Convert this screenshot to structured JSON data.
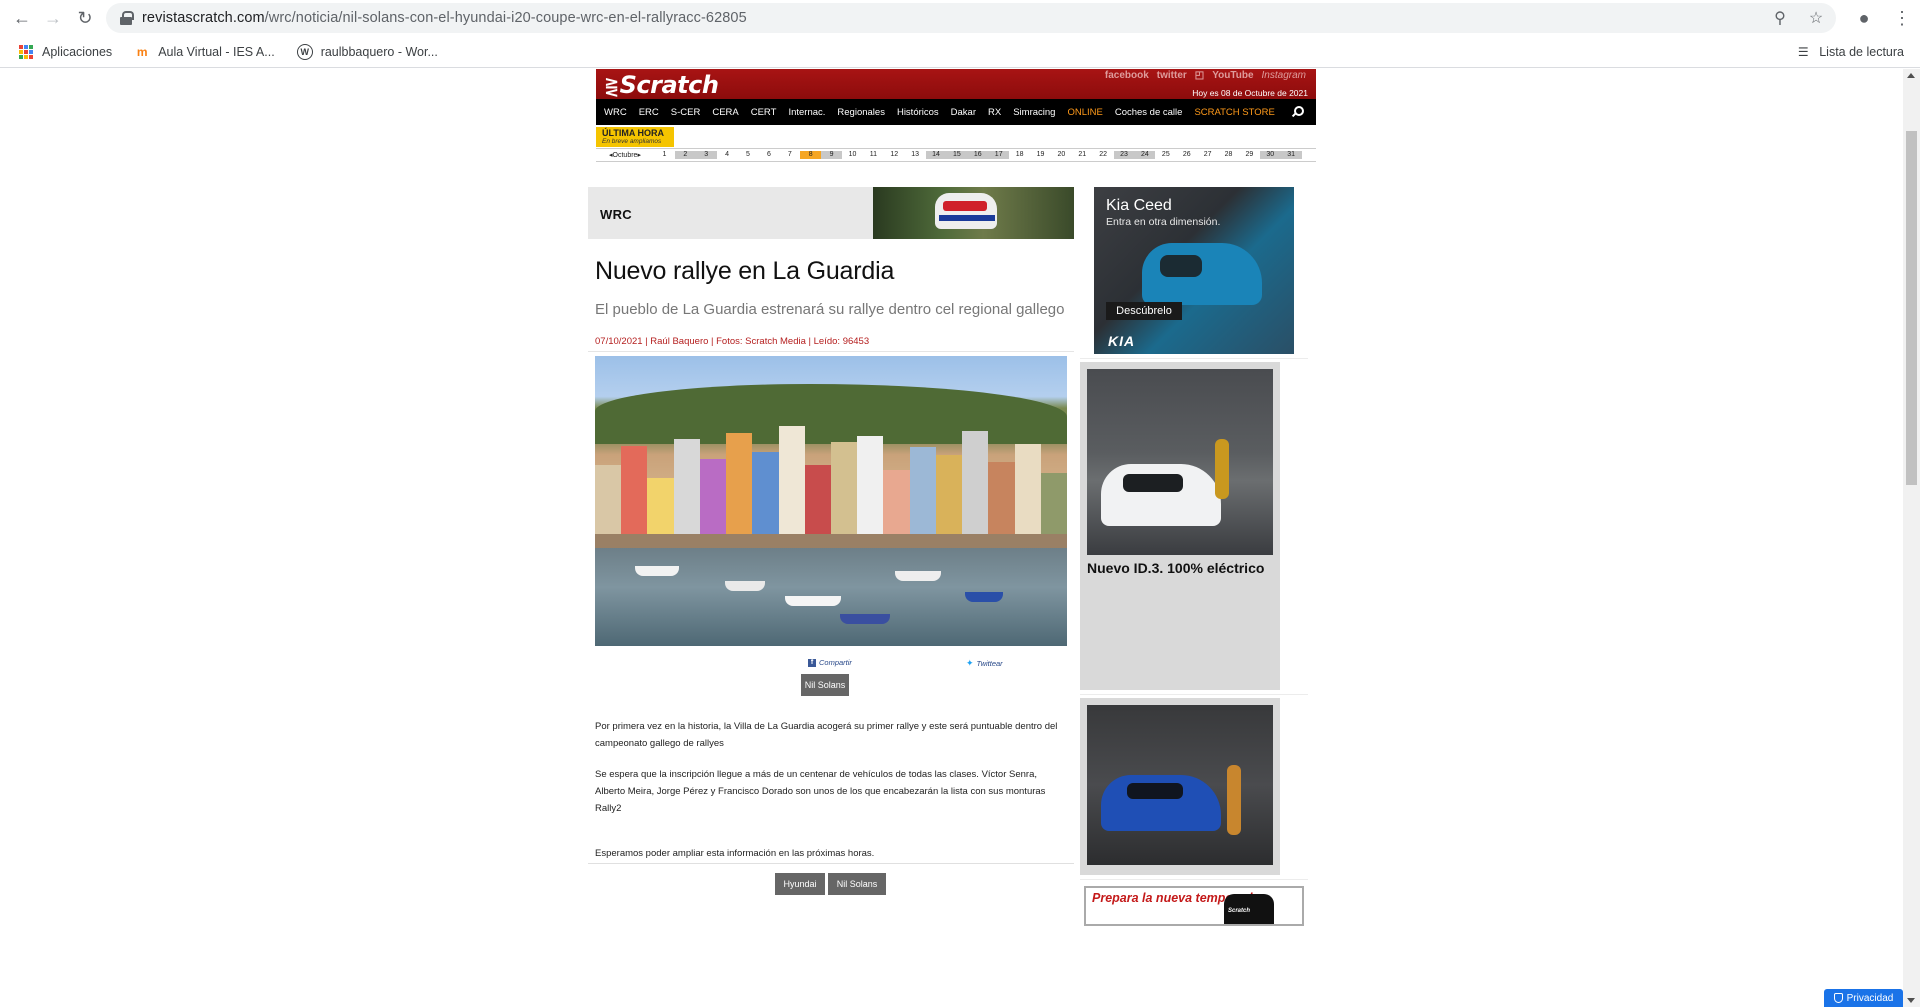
{
  "browser": {
    "url_host": "revistascratch.com",
    "url_path": "/wrc/noticia/nil-solans-con-el-hyundai-i20-coupe-wrc-en-el-rallyracc-62805",
    "bookmarks": [
      {
        "label": "Aplicaciones",
        "icon": "apps-grid-icon"
      },
      {
        "label": "Aula Virtual - IES A...",
        "icon": "moodle-icon"
      },
      {
        "label": "raulbbaquero - Wor...",
        "icon": "wordpress-icon"
      }
    ],
    "reading_list": "Lista de lectura"
  },
  "site": {
    "logo": "Scratch",
    "social": [
      "facebook",
      "twitter",
      "rss",
      "YouTube",
      "Instagram"
    ],
    "today": "Hoy es 08 de Octubre de 2021",
    "nav": [
      {
        "label": "WRC",
        "color": "#ffffff"
      },
      {
        "label": "ERC",
        "color": "#ffffff"
      },
      {
        "label": "S-CER",
        "color": "#ffffff"
      },
      {
        "label": "CERA",
        "color": "#ffffff"
      },
      {
        "label": "CERT",
        "color": "#ffffff"
      },
      {
        "label": "Internac.",
        "color": "#ffffff"
      },
      {
        "label": "Regionales",
        "color": "#ffffff"
      },
      {
        "label": "Históricos",
        "color": "#ffffff"
      },
      {
        "label": "Dakar",
        "color": "#ffffff"
      },
      {
        "label": "RX",
        "color": "#ffffff"
      },
      {
        "label": "Simracing",
        "color": "#ffffff"
      },
      {
        "label": "ONLINE",
        "color": "#ff9a1a"
      },
      {
        "label": "Coches de calle",
        "color": "#ffffff"
      },
      {
        "label": "SCRATCH STORE",
        "color": "#ff9a1a"
      }
    ],
    "breaking_title": "ÚLTIMA HORA",
    "breaking_sub": "En breve ampliamos",
    "calendar_month": "◂Octubre▸",
    "calendar_days": [
      "1",
      "2",
      "3",
      "4",
      "5",
      "6",
      "7",
      "8",
      "9",
      "10",
      "11",
      "12",
      "13",
      "14",
      "15",
      "16",
      "17",
      "18",
      "19",
      "20",
      "21",
      "22",
      "23",
      "24",
      "25",
      "26",
      "27",
      "28",
      "29",
      "30",
      "31"
    ],
    "weekend_days": [
      "2",
      "3",
      "9",
      "14",
      "15",
      "16",
      "17",
      "23",
      "24",
      "30",
      "31"
    ],
    "today_day": "8"
  },
  "article": {
    "section": "WRC",
    "headline": "Nuevo rallye en La Guardia",
    "subhead": "El pueblo de La Guardia estrenará su rallye dentro cel regional gallego",
    "meta": "07/10/2021 | Raúl Baquero | Fotos: Scratch Media | Leído: 96453",
    "share_facebook": "Compartir",
    "share_twitter": "Twittear",
    "top_tag": "Nil Solans",
    "paragraphs": [
      "Por primera vez en la historia, la Villa de La Guardia acogerá su primer rallye y este será puntuable dentro del campeonato gallego de rallyes",
      "Se espera que la inscripción llegue a más de un centenar de vehículos de todas las clases. Víctor Senra, Alberto Meira, Jorge Pérez y Francisco Dorado son unos de los que encabezarán la lista con sus monturas Rally2",
      "Esperamos poder ampliar esta información en las próximas horas."
    ],
    "bottom_tags": [
      "Hyundai",
      "Nil Solans"
    ]
  },
  "sidebar": {
    "ad1_title": "Kia Ceed",
    "ad1_tagline": "Entra en otra dimensión.",
    "ad1_cta": "Descúbrelo",
    "ad1_brand": "KIA",
    "ad2_caption": "Nuevo ID.3. 100% eléctrico",
    "ad4_text": "Prepara la nueva temporada",
    "ad4_shirt": "Scratch"
  },
  "privacy": "Privacidad"
}
